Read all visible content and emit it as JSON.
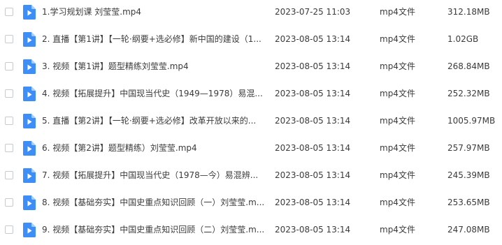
{
  "accent_color": "#3e8ef7",
  "file_icon": "video-file-icon",
  "files": [
    {
      "name": "1.学习规划课 刘莹莹.mp4",
      "date": "2023-07-25 11:03",
      "type": "mp4文件",
      "size": "312.18MB"
    },
    {
      "name": "2. 直播【第1讲】【一轮·纲要+选必修】新中国的建设（1...",
      "date": "2023-08-05 13:14",
      "type": "mp4文件",
      "size": "1.02GB"
    },
    {
      "name": "3. 视频【第1讲】题型精练刘莹莹.mp4",
      "date": "2023-08-05 13:14",
      "type": "mp4文件",
      "size": "268.84MB"
    },
    {
      "name": "4. 视频【拓展提升】中国现当代史（1949—1978）易混...",
      "date": "2023-08-05 13:14",
      "type": "mp4文件",
      "size": "252.32MB"
    },
    {
      "name": "5. 直播【第2讲】【一轮·纲要+选必修】改革开放以来的...",
      "date": "2023-08-05 13:14",
      "type": "mp4文件",
      "size": "1005.97MB"
    },
    {
      "name": "6. 视频【第2讲】题型精练）刘莹莹.mp4",
      "date": "2023-08-05 13:14",
      "type": "mp4文件",
      "size": "257.97MB"
    },
    {
      "name": "7. 视频【拓展提升】中国现当代史（1978—今）易混辨...",
      "date": "2023-08-05 13:14",
      "type": "mp4文件",
      "size": "245.39MB"
    },
    {
      "name": "8. 视频【基础夯实】中国史重点知识回顾（一）刘莹莹.m...",
      "date": "2023-08-05 13:14",
      "type": "mp4文件",
      "size": "253.65MB"
    },
    {
      "name": "9. 视频【基础夯实】中国史重点知识回顾（二）刘莹莹.m...",
      "date": "2023-08-05 13:14",
      "type": "mp4文件",
      "size": "247.08MB"
    }
  ]
}
